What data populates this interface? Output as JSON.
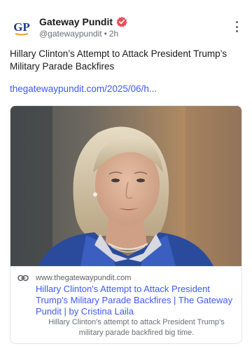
{
  "author": {
    "name": "Gateway Pundit",
    "handle": "@gatewaypundit",
    "time": "2h",
    "avatar_text": "GP",
    "verified": true
  },
  "post": {
    "text": "Hillary Clinton’s Attempt to Attack President Trump’s Military Parade Backfires",
    "link": "thegatewaypundit.com/2025/06/h..."
  },
  "card": {
    "domain": "www.thegatewaypundit.com",
    "title": "Hillary Clinton's Attempt to Attack President Trump's Military Parade Backfires | The Gateway Pundit | by Cristina Laila",
    "description": "Hillary Clinton’s attempt to attack President Trump’s military parade backfired big time."
  },
  "colors": {
    "link": "#3d5afe",
    "verified": "#e8505b",
    "avatar_brand": "#1f3b8c",
    "avatar_accent": "#e8a52a"
  },
  "icons": {
    "verified": "verified-badge-icon",
    "more": "more-vertical-icon",
    "link": "link-chain-icon"
  }
}
